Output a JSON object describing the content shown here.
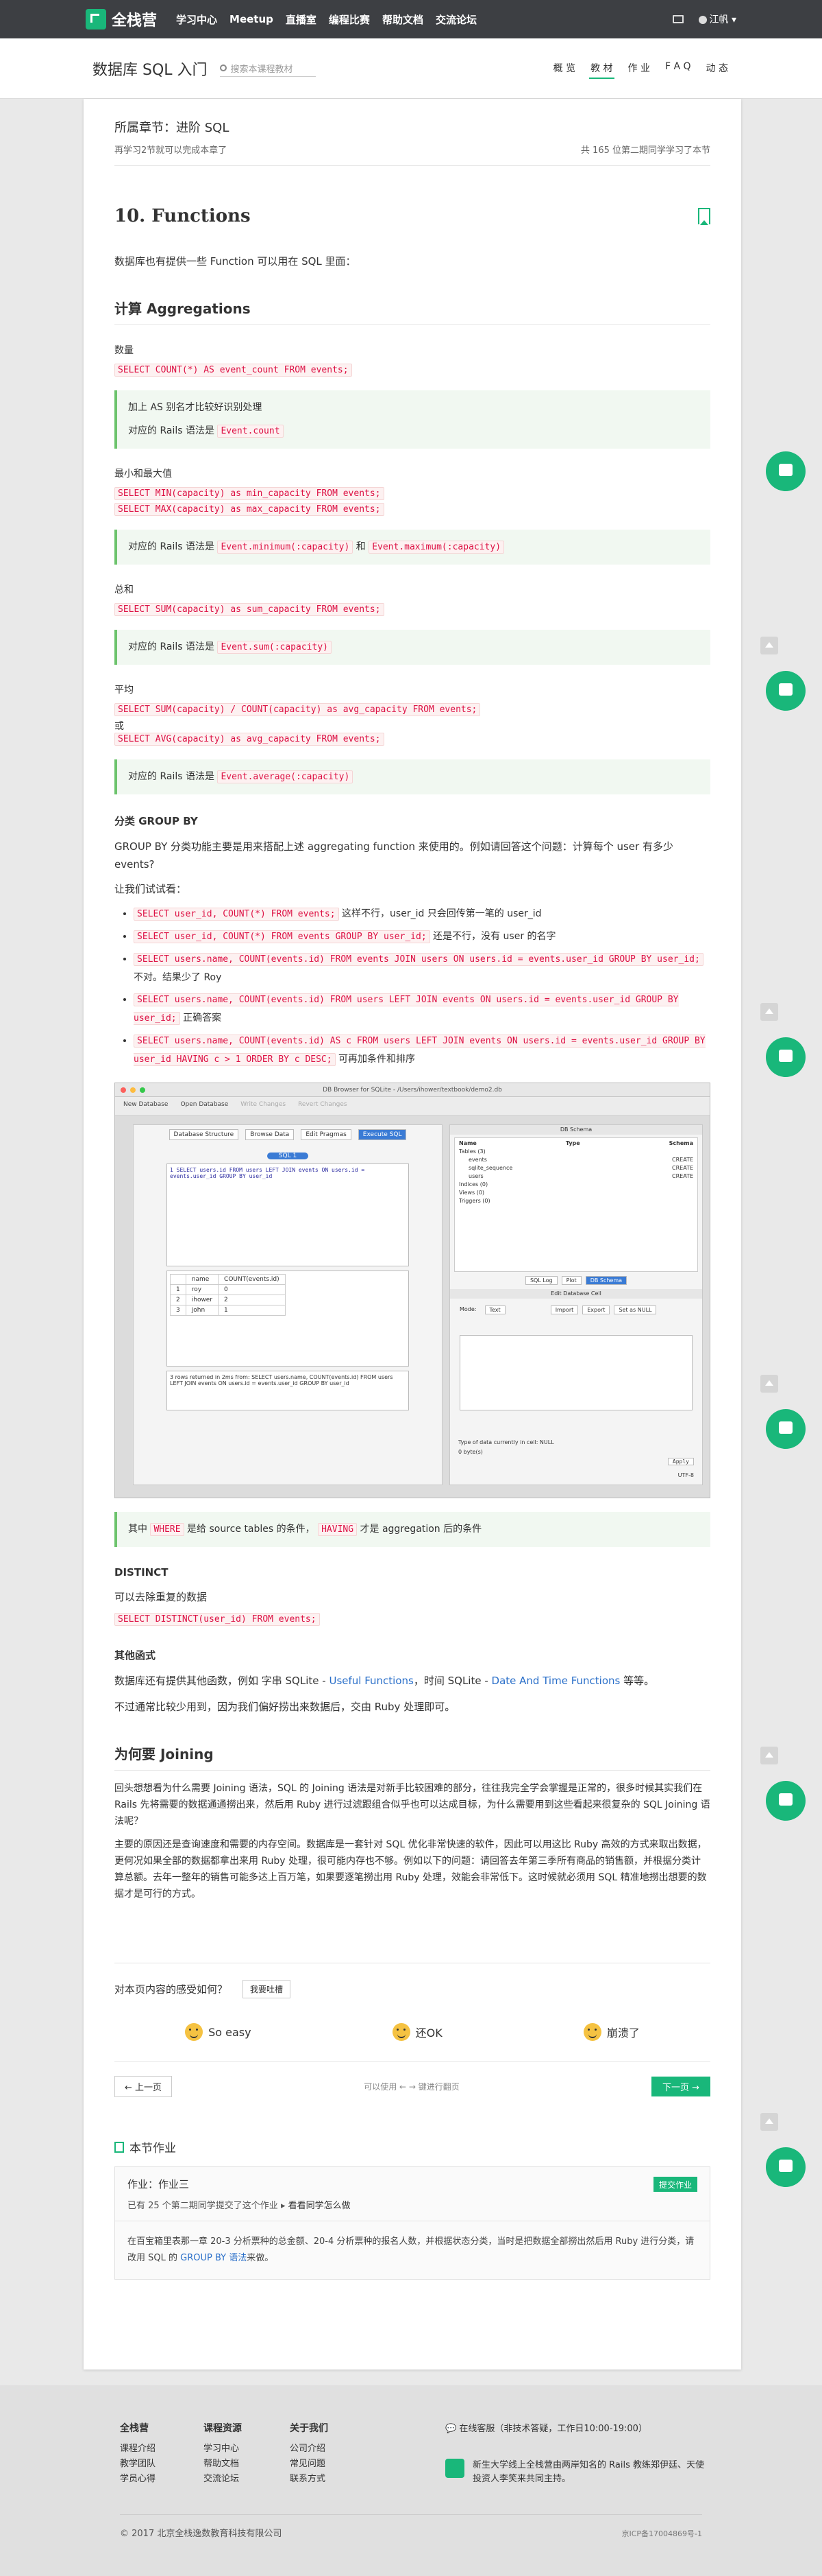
{
  "topnav": {
    "logo": "全栈营",
    "links": [
      "学习中心",
      "Meetup",
      "直播室",
      "编程比赛",
      "帮助文档",
      "交流论坛"
    ],
    "user": "江帆"
  },
  "course": {
    "title": "数据库 SQL 入门",
    "search_placeholder": "搜索本课程教材",
    "tabs": [
      "概 览",
      "教 材",
      "作 业",
      "F A Q",
      "动 态"
    ]
  },
  "lesson": {
    "chapter": "所属章节：进阶 SQL",
    "progress_left": "再学习2节就可以完成本章了",
    "progress_right": "共 165 位第二期同学学习了本节",
    "title": "10. Functions",
    "intro": "数据库也有提供一些 Function 可以用在 SQL 里面：",
    "h_agg": "计算 Aggregations",
    "count_label": "数量",
    "count_sql": "SELECT COUNT(*) AS event_count FROM events;",
    "note1_line1": "加上 AS 别名才比较好识别处理",
    "note1_line2_prefix": "对应的 Rails 语法是",
    "note1_code": "Event.count",
    "minmax_label": "最小和最大值",
    "min_sql": "SELECT MIN(capacity) as min_capacity FROM events;",
    "max_sql": "SELECT MAX(capacity) as max_capacity FROM events;",
    "note2_prefix": "对应的 Rails 语法是",
    "note2_code1": "Event.minimum(:capacity)",
    "note2_and": "和",
    "note2_code2": "Event.maximum(:capacity)",
    "sum_label": "总和",
    "sum_sql": "SELECT SUM(capacity) as sum_capacity FROM events;",
    "note3_prefix": "对应的 Rails 语法是",
    "note3_code": "Event.sum(:capacity)",
    "avg_label": "平均",
    "avg_sql1": "SELECT SUM(capacity) / COUNT(capacity) as avg_capacity FROM events;",
    "avg_or": "或",
    "avg_sql2": "SELECT AVG(capacity) as avg_capacity FROM events;",
    "note4_prefix": "对应的 Rails 语法是",
    "note4_code": "Event.average(:capacity)",
    "h_group": "分类 GROUP BY",
    "group_p": "GROUP BY 分类功能主要是用来搭配上述 aggregating function 来使用的。例如请回答这个问题：计算每个 user 有多少 events?",
    "try_label": "让我们试试看：",
    "tries": [
      {
        "code": "SELECT user_id, COUNT(*) FROM events;",
        "text": " 这样不行，user_id 只会回传第一笔的 user_id"
      },
      {
        "code": "SELECT user_id, COUNT(*) FROM events GROUP BY user_id;",
        "text": " 还是不行，没有 user 的名字"
      },
      {
        "code": "SELECT users.name, COUNT(events.id) FROM events JOIN users ON users.id = events.user_id GROUP BY user_id;",
        "text": " 不对。结果少了 Roy"
      },
      {
        "code": "SELECT users.name, COUNT(events.id) FROM users LEFT JOIN events ON users.id = events.user_id GROUP BY user_id;",
        "text": " 正确答案"
      },
      {
        "code": "SELECT users.name, COUNT(events.id) AS c FROM users LEFT JOIN events ON users.id = events.user_id GROUP BY user_id HAVING c > 1 ORDER BY c DESC;",
        "text": " 可再加条件和排序"
      }
    ],
    "note5_prefix": "其中",
    "note5_code1": "WHERE",
    "note5_mid": "是给 source tables 的条件，",
    "note5_code2": "HAVING",
    "note5_suffix": "才是 aggregation 后的条件",
    "h_distinct": "DISTINCT",
    "distinct_p": "可以去除重复的数据",
    "distinct_sql": "SELECT DISTINCT(user_id) FROM events;",
    "h_other": "其他函式",
    "other_p_prefix": "数据库还有提供其他函数，例如 字串 SQLite -",
    "other_link1": "Useful Functions",
    "other_p_mid": "，时间 SQLite -",
    "other_link2": "Date And Time Functions",
    "other_p_suffix": "等等。",
    "other_p2": "不过通常比较少用到，因为我们偏好捞出来数据后，交由 Ruby 处理即可。",
    "h_join": "为何要 Joining",
    "join_p1": "回头想想看为什么需要 Joining 语法，SQL 的 Joining 语法是对新手比较困难的部分，往往我完全学会掌握是正常的，很多时候其实我们在 Rails 先将需要的数据通通撈出来，然后用 Ruby 进行过滤跟组合似乎也可以达成目标，为什么需要用到这些看起来很复杂的 SQL Joining 语法呢？",
    "join_p2": "主要的原因还是查询速度和需要的内存空间。数据库是一套针对 SQL 优化非常快速的软件，因此可以用这比 Ruby 高效的方式来取出数据，更何况如果全部的数据都拿出来用 Ruby 处理，很可能内存也不够。例如以下的问题：请回答去年第三季所有商品的销售额，并根据分类计算总额。去年一整年的销售可能多达上百万笔，如果要逐笔撈出用 Ruby 处理，效能会非常低下。这时候就必须用 SQL 精准地撈出想要的数据才是可行的方式。"
  },
  "screenshot": {
    "window_title": "DB Browser for SQLite - /Users/ihower/textbook/demo2.db",
    "toolbar": [
      "New Database",
      "Open Database",
      "Write Changes",
      "Revert Changes"
    ],
    "tabs": [
      "Database Structure",
      "Browse Data",
      "Edit Pragmas",
      "Execute SQL"
    ],
    "sql_tab": "SQL 1",
    "sql_text": "1  SELECT users.id FROM users LEFT JOIN events ON users.id = events.user_id GROUP BY user_id",
    "result_header": [
      "name",
      "COUNT(events.id)"
    ],
    "result_rows": [
      [
        "1",
        "roy",
        "0"
      ],
      [
        "2",
        "ihower",
        "2"
      ],
      [
        "3",
        "john",
        "1"
      ]
    ],
    "message": "3 rows returned in 2ms from: SELECT users.name, COUNT(events.id) FROM users LEFT JOIN events ON users.id = events.user_id GROUP BY user_id",
    "schema_title": "DB Schema",
    "schema_cols": [
      "Name",
      "Type",
      "Schema"
    ],
    "schema_rows": [
      {
        "name": "Tables (3)",
        "schema": ""
      },
      {
        "name": "events",
        "schema": "CREATE"
      },
      {
        "name": "sqlite_sequence",
        "schema": "CREATE"
      },
      {
        "name": "users",
        "schema": "CREATE"
      },
      {
        "name": "Indices (0)",
        "schema": ""
      },
      {
        "name": "Views (0)",
        "schema": ""
      },
      {
        "name": "Triggers (0)",
        "schema": ""
      }
    ],
    "right_tabs": [
      "SQL Log",
      "Plot",
      "DB Schema"
    ],
    "edit_title": "Edit Database Cell",
    "mode_label": "Mode:",
    "mode_value": "Text",
    "edit_buttons": [
      "Import",
      "Export",
      "Set as NULL"
    ],
    "type_text": "Type of data currently in cell: NULL",
    "size_text": "0 byte(s)",
    "apply": "Apply",
    "encoding": "UTF-8"
  },
  "feedback": {
    "question": "对本页内容的感受如何？",
    "button": "我要吐槽",
    "moods": [
      "So easy",
      "还OK",
      "崩溃了"
    ]
  },
  "pager": {
    "prev": "上一页",
    "hint": "可以使用 ← → 键进行翻页",
    "next": "下一页"
  },
  "homework": {
    "title": "本节作业",
    "name": "作业：作业三",
    "count_text": "已有 25 个第二期同学提交了这个作业",
    "see_link": "看看同学怎么做",
    "submit": "提交作业",
    "desc_prefix": "在百宝箱里表那一章 20-3 分析票种的总金额、20-4 分析票种的报名人数，并根据状态分类，当时是把数据全部撈出然后用 Ruby 进行分类，请改用 SQL 的",
    "desc_link": "GROUP BY 语法",
    "desc_suffix": "来做。"
  },
  "footer": {
    "cols": [
      {
        "title": "全栈营",
        "items": [
          "课程介绍",
          "教学团队",
          "学员心得"
        ]
      },
      {
        "title": "课程资源",
        "items": [
          "学习中心",
          "帮助文档",
          "交流论坛"
        ]
      },
      {
        "title": "关于我们",
        "items": [
          "公司介绍",
          "常见问题",
          "联系方式"
        ]
      }
    ],
    "support": "在线客服（非技术答疑，工作日10:00-19:00）",
    "brand_text": "新生大学线上全栈营由两岸知名的 Rails 教练郑伊廷、天使投资人李笑来共同主持。",
    "copyright": "© 2017 北京全栈逸数教育科技有限公司",
    "beian": "京ICP备17004869号-1"
  }
}
